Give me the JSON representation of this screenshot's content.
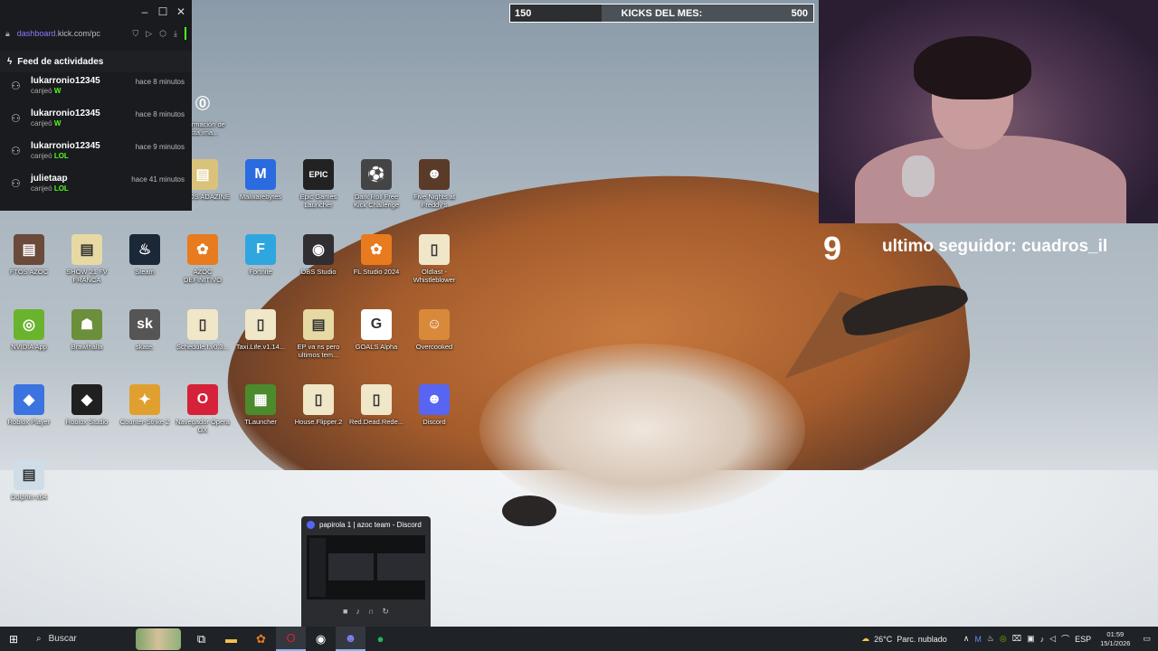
{
  "browser": {
    "url_highlight": "dashboard.",
    "url_rest": "kick.com/pc",
    "feed_title": "Feed de actividades",
    "feed": [
      {
        "user": "lukarronio12345",
        "action": "canjeó",
        "reward": "W",
        "time": "hace 8 minutos"
      },
      {
        "user": "lukarronio12345",
        "action": "canjeó",
        "reward": "W",
        "time": "hace 8 minutos"
      },
      {
        "user": "lukarronio12345",
        "action": "canjeó",
        "reward": "LOL",
        "time": "hace 9 minutos"
      },
      {
        "user": "julietaap",
        "action": "canjeó",
        "reward": "LOL",
        "time": "hace 41 minutos"
      }
    ]
  },
  "kicks_goal": {
    "current": "150",
    "title": "KICKS DEL MES:",
    "goal": "500",
    "progress": 0.3
  },
  "stream_overlay": {
    "counter": "9",
    "last_follower": "ultimo seguidor: cuadros_il"
  },
  "desktop_icons": [
    {
      "label": "Información de esta ima...",
      "icon": "info-icon",
      "color": "transparent",
      "glyph": "⓪"
    },
    {
      "label": "FOTOS ADAZINE",
      "icon": "folder-icon",
      "color": "#d9c27a",
      "glyph": "▤"
    },
    {
      "label": "Malwarebytes",
      "icon": "malwarebytes-icon",
      "color": "#2b6be0",
      "glyph": "M"
    },
    {
      "label": "Epic Games Launcher",
      "icon": "epic-games-icon",
      "color": "#222222",
      "glyph": "EPIC"
    },
    {
      "label": "Dark Roll Free Kick Challenge",
      "icon": "soccer-ball-icon",
      "color": "#444444",
      "glyph": "⚽"
    },
    {
      "label": "Five Nights at Freddy's",
      "icon": "freddy-icon",
      "color": "#5a3a28",
      "glyph": "☻"
    },
    {
      "label": "FTOS AZOC",
      "icon": "folder-icon",
      "color": "#6a4a3a",
      "glyph": "▤"
    },
    {
      "label": "SHOW 21 FV FRANCA",
      "icon": "folder-icon",
      "color": "#e6d9a3",
      "glyph": "▤"
    },
    {
      "label": "Steam",
      "icon": "steam-icon",
      "color": "#1b2838",
      "glyph": "♨"
    },
    {
      "label": "AZOC DEFINITIVO",
      "icon": "fl-studio-icon",
      "color": "#e87b1e",
      "glyph": "✿"
    },
    {
      "label": "Fortnite",
      "icon": "fortnite-icon",
      "color": "#2fa6e0",
      "glyph": "F"
    },
    {
      "label": "OBS Studio",
      "icon": "obs-icon",
      "color": "#302e31",
      "glyph": "◉"
    },
    {
      "label": "FL Studio 2024",
      "icon": "fl-studio-icon",
      "color": "#e87b1e",
      "glyph": "✿"
    },
    {
      "label": "Oldlast - Whistleblower",
      "icon": "file-icon",
      "color": "#f0e6c8",
      "glyph": "▯"
    },
    {
      "label": "NVIDIA App",
      "icon": "nvidia-icon",
      "color": "#6ab42d",
      "glyph": "◎"
    },
    {
      "label": "Brawlhalla",
      "icon": "brawlhalla-icon",
      "color": "#6b8f3a",
      "glyph": "☗"
    },
    {
      "label": "skate.",
      "icon": "skate-icon",
      "color": "#555555",
      "glyph": "sk"
    },
    {
      "label": "Schedule.I.v0.3...",
      "icon": "file-icon",
      "color": "#f0e6c8",
      "glyph": "▯"
    },
    {
      "label": "Taxi.Life.v1.14...",
      "icon": "file-icon",
      "color": "#f0e6c8",
      "glyph": "▯"
    },
    {
      "label": "EP va ns pero ultimos tem...",
      "icon": "folder-icon",
      "color": "#e6d9a3",
      "glyph": "▤"
    },
    {
      "label": "GOALS Alpha",
      "icon": "goals-icon",
      "color": "#ffffff",
      "glyph": "G"
    },
    {
      "label": "Overcooked",
      "icon": "overcooked-icon",
      "color": "#d9893a",
      "glyph": "☺"
    },
    {
      "label": "Roblox Player",
      "icon": "roblox-icon",
      "color": "#3b73e0",
      "glyph": "◆"
    },
    {
      "label": "Roblox Studio",
      "icon": "roblox-studio-icon",
      "color": "#202020",
      "glyph": "◆"
    },
    {
      "label": "Counter-Strike 2",
      "icon": "counter-strike-icon",
      "color": "#e0a030",
      "glyph": "✦"
    },
    {
      "label": "Navegador Opera GX",
      "icon": "opera-gx-icon",
      "color": "#d6213a",
      "glyph": "O"
    },
    {
      "label": "TLauncher",
      "icon": "minecraft-icon",
      "color": "#4c8a2e",
      "glyph": "▦"
    },
    {
      "label": "House.Flipper.2",
      "icon": "file-icon",
      "color": "#f0e6c8",
      "glyph": "▯"
    },
    {
      "label": "Red.Dead.Rede...",
      "icon": "file-icon",
      "color": "#f0e6c8",
      "glyph": "▯"
    },
    {
      "label": "Discord",
      "icon": "discord-icon",
      "color": "#5865f2",
      "glyph": "☻"
    },
    {
      "label": "Dolphin-x64",
      "icon": "folder-icon",
      "color": "#cfdde8",
      "glyph": "▤"
    }
  ],
  "discord_preview": {
    "title": "papirola 1 | azoc team - Discord"
  },
  "taskbar": {
    "search_label": "Buscar",
    "weather_temp": "26°C",
    "weather_desc": "Parc. nublado",
    "language": "ESP",
    "time": "01:59",
    "date": "15/1/2026",
    "accent": "#8ab4f8"
  }
}
